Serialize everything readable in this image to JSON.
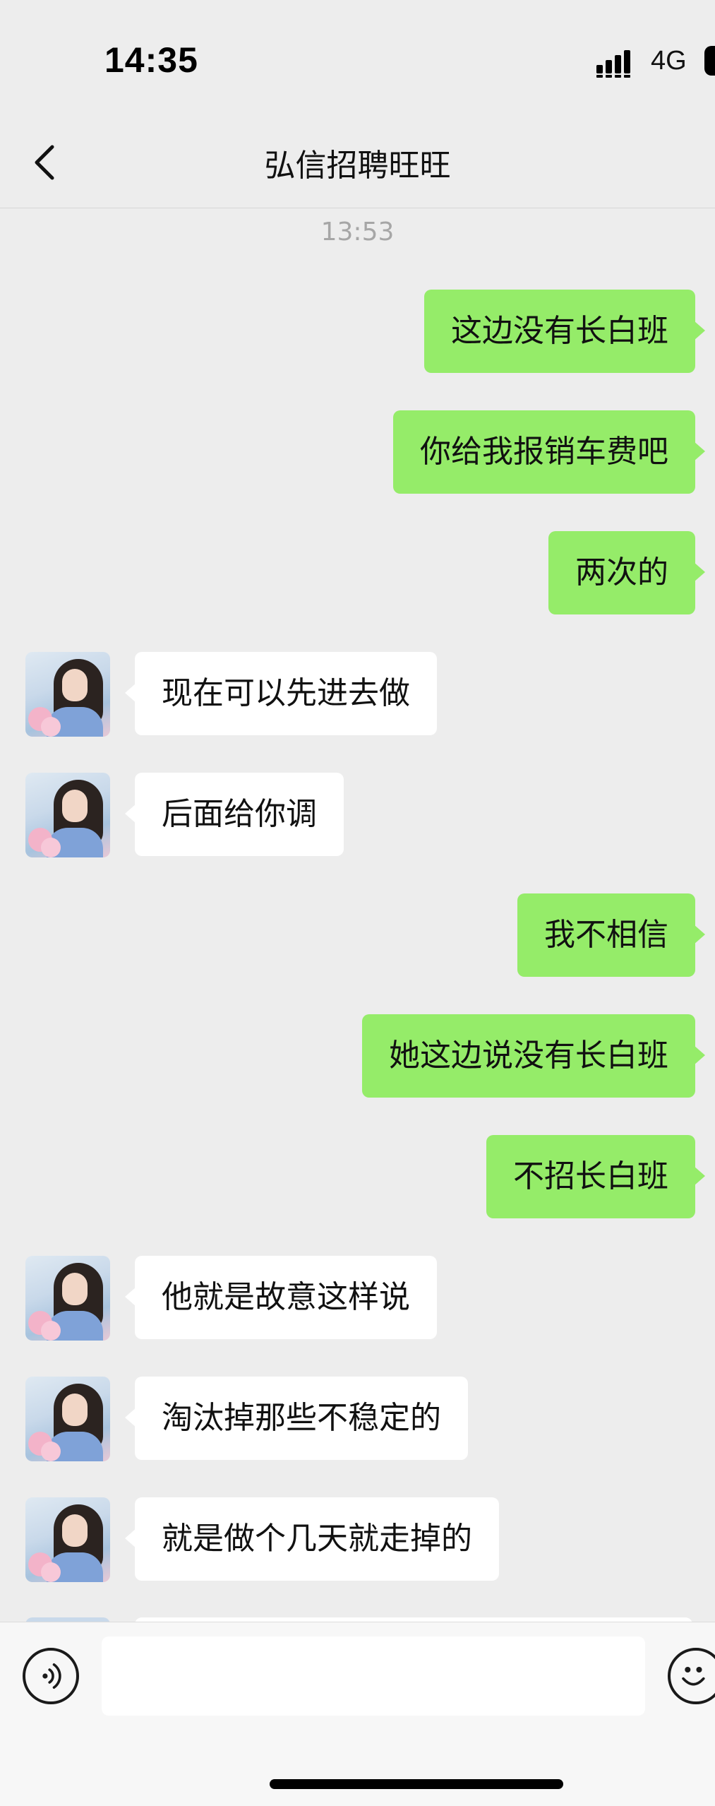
{
  "status_bar": {
    "time": "14:35",
    "network": "4G",
    "signal_icon": "signal-bars-icon",
    "battery_icon": "battery-icon"
  },
  "nav": {
    "title": "弘信招聘旺旺",
    "back_icon": "chevron-left-icon"
  },
  "timestamp": "13:53",
  "messages": [
    {
      "dir": "out",
      "text": "这边没有长白班"
    },
    {
      "dir": "out",
      "text": "你给我报销车费吧"
    },
    {
      "dir": "out",
      "text": "两次的"
    },
    {
      "dir": "in",
      "text": "现在可以先进去做"
    },
    {
      "dir": "in",
      "text": "后面给你调"
    },
    {
      "dir": "out",
      "text": "我不相信"
    },
    {
      "dir": "out",
      "text": "她这边说没有长白班"
    },
    {
      "dir": "out",
      "text": "不招长白班"
    },
    {
      "dir": "in",
      "text": "他就是故意这样说"
    },
    {
      "dir": "in",
      "text": "淘汰掉那些不稳定的"
    },
    {
      "dir": "in",
      "text": "就是做个几天就走掉的"
    }
  ],
  "input_bar": {
    "value": "",
    "voice_icon": "voice-icon",
    "emoji_icon": "emoji-icon"
  },
  "colors": {
    "background": "#ededed",
    "outgoing_bubble": "#95ec69",
    "incoming_bubble": "#ffffff",
    "timestamp": "#a6a6a6"
  }
}
